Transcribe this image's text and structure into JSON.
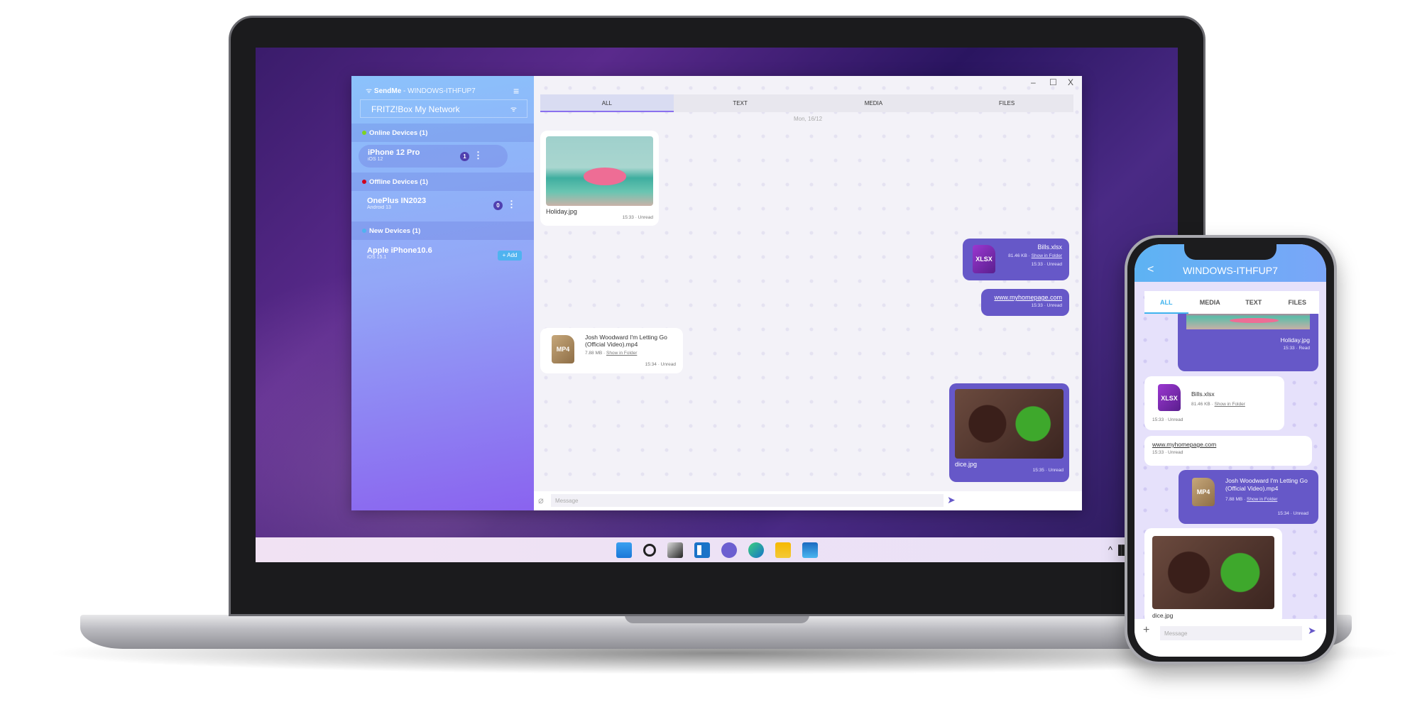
{
  "app": {
    "name": "SendMe",
    "host": "WINDOWS-ITHFUP7",
    "network": "FRITZ!Box My Network"
  },
  "sidebar": {
    "sections": [
      {
        "label": "Online Devices (1)",
        "color": "#7ed321"
      },
      {
        "label": "Offline Devices (1)",
        "color": "#d0021b"
      },
      {
        "label": "New Devices (1)",
        "color": "#4fb3f0"
      }
    ],
    "devices": [
      {
        "name": "iPhone 12 Pro",
        "os": "iOS 12",
        "badge": "1"
      },
      {
        "name": "OnePlus IN2023",
        "os": "Android 13",
        "badge": "0"
      },
      {
        "name": "Apple iPhone10.6",
        "os": "iOS 15.1",
        "action": "+ Add"
      }
    ]
  },
  "window_controls": {
    "minimize": "–",
    "maximize": "☐",
    "close": "X"
  },
  "tabs": [
    "ALL",
    "TEXT",
    "MEDIA",
    "FILES"
  ],
  "date": "Mon, 16/12",
  "messages": [
    {
      "file": "Holiday.jpg",
      "meta": "15:33 · Unread"
    },
    {
      "file": "Bills.xlsx",
      "type": "XLSX",
      "size": "81.46 KB",
      "action": "Show in Folder",
      "meta": "15:33 · Unread"
    },
    {
      "text": "www.myhomepage.com",
      "meta": "15:33 · Unread"
    },
    {
      "file": "Josh Woodward I'm Letting Go (Official Video).mp4",
      "type": "MP4",
      "size": "7.88 MB",
      "action": "Show in Folder",
      "meta": "15:34 · Unread"
    },
    {
      "file": "dice.jpg",
      "meta": "15:35 · Unread"
    }
  ],
  "input": {
    "placeholder": "Message"
  },
  "taskbar": {
    "tray": "^ ▐▌ ᯤ 🔊 ▮"
  },
  "phone": {
    "title": "WINDOWS-ITHFUP7",
    "back": "<",
    "tabs": [
      "ALL",
      "MEDIA",
      "TEXT",
      "FILES"
    ],
    "messages": [
      {
        "file": "Holiday.jpg",
        "meta": "15:33 · Read"
      },
      {
        "file": "Bills.xlsx",
        "type": "XLSX",
        "size": "81.46 KB",
        "action": "Show in Folder",
        "meta": "15:33 · Unread"
      },
      {
        "text": "www.myhomepage.com",
        "meta": "15:33 · Unread"
      },
      {
        "file": "Josh Woodward I'm Letting Go (Official Video).mp4",
        "type": "MP4",
        "size": "7.88 MB",
        "action": "Show in Folder",
        "meta": "15:34 · Unread"
      },
      {
        "file": "dice.jpg"
      }
    ],
    "input": {
      "placeholder": "Message",
      "add": "+"
    }
  }
}
